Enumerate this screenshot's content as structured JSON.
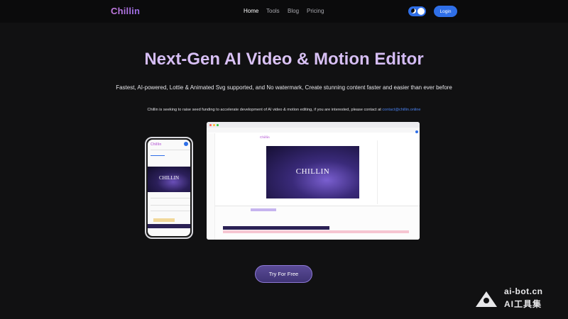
{
  "header": {
    "logo": "Chillin",
    "nav": [
      "Home",
      "Tools",
      "Blog",
      "Pricing"
    ],
    "login_label": "Login"
  },
  "hero": {
    "title": "Next-Gen AI Video & Motion Editor",
    "subtitle": "Fastest, AI-powered, Lottie & Animated Svg supported, and No watermark, Create stunning content faster and easier than ever before",
    "notice_text": "Chillin is seeking to raise seed funding to accelerate development of AI video & motion editing, if you are interested, please contact at ",
    "notice_email": "contact@chillin.online",
    "cta_label": "Try For Free"
  },
  "mockups": {
    "video_text": "CHILLIN",
    "app_logo": "Chillin"
  },
  "watermark": {
    "line1": "ai-bot.cn",
    "line2": "AI工具集"
  },
  "colors": {
    "accent": "#2f6fe8",
    "brand": "#c57bde",
    "cta_bg": "#4b3f86"
  }
}
